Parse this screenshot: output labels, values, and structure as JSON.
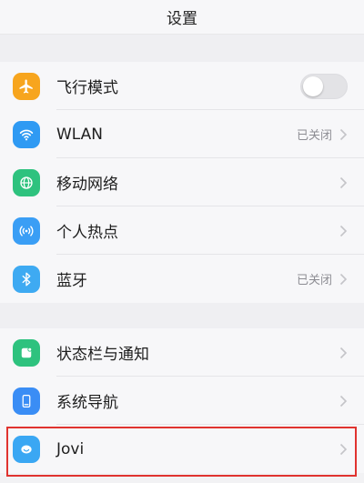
{
  "header": {
    "title": "设置"
  },
  "colors": {
    "airplane": "#f7a51e",
    "wlan": "#2f9af3",
    "mobile": "#2ec27e",
    "hotspot": "#3a9ef5",
    "bluetooth": "#3eaaf2",
    "statusbar": "#2ec27e",
    "navigation": "#3a8df5",
    "jovi": "#3aa7f3",
    "highlight": "#e0332f"
  },
  "group1": {
    "items": [
      {
        "label": "飞行模式",
        "icon": "airplane-icon",
        "control": "toggle",
        "toggle_on": false
      },
      {
        "label": "WLAN",
        "icon": "wifi-icon",
        "status": "已关闭"
      },
      {
        "label": "移动网络",
        "icon": "globe-icon"
      },
      {
        "label": "个人热点",
        "icon": "hotspot-icon"
      },
      {
        "label": "蓝牙",
        "icon": "bluetooth-icon",
        "status": "已关闭"
      }
    ]
  },
  "group2": {
    "items": [
      {
        "label": "状态栏与通知",
        "icon": "notification-icon"
      },
      {
        "label": "系统导航",
        "icon": "navigation-icon"
      },
      {
        "label": "Jovi",
        "icon": "jovi-icon"
      }
    ]
  }
}
